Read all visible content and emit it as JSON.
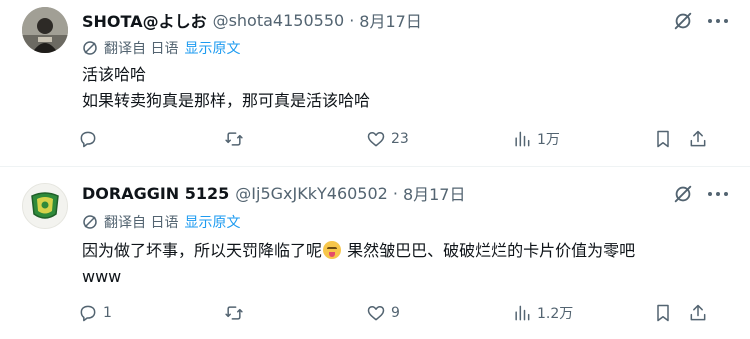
{
  "tweets": [
    {
      "name": "SHOTA@よしお",
      "handle": "@shota4150550",
      "separator": "·",
      "date": "8月17日",
      "translate_label": "翻译自 日语",
      "show_original": "显示原文",
      "lines": [
        "活该哈哈",
        "如果转卖狗真是那样，那可真是活该哈哈"
      ],
      "replies": "",
      "retweets": "",
      "likes": "23",
      "views": "1万"
    },
    {
      "name": "DORAGGIN 5125",
      "handle": "@Ij5GxJKkY460502",
      "separator": "·",
      "date": "8月17日",
      "translate_label": "翻译自 日语",
      "show_original": "显示原文",
      "line1_before": "因为做了坏事，所以天罚降临了呢",
      "line1_after": " 果然皱巴巴、破破烂烂的卡片价值为零吧",
      "line2": "www",
      "replies": "1",
      "retweets": "",
      "likes": "9",
      "views": "1.2万"
    }
  ],
  "icons": {
    "grok": "grok-icon",
    "more": "more-dots-icon",
    "translate": "translate-globe-icon",
    "reply": "reply-icon",
    "retweet": "retweet-icon",
    "like": "heart-icon",
    "views": "views-chart-icon",
    "bookmark": "bookmark-icon",
    "share": "share-icon",
    "emoji": "squinting-tongue-emoji"
  },
  "colors": {
    "text": "#0f1419",
    "secondary": "#536471",
    "link": "#1d9bf0",
    "divider": "#eff3f4"
  }
}
